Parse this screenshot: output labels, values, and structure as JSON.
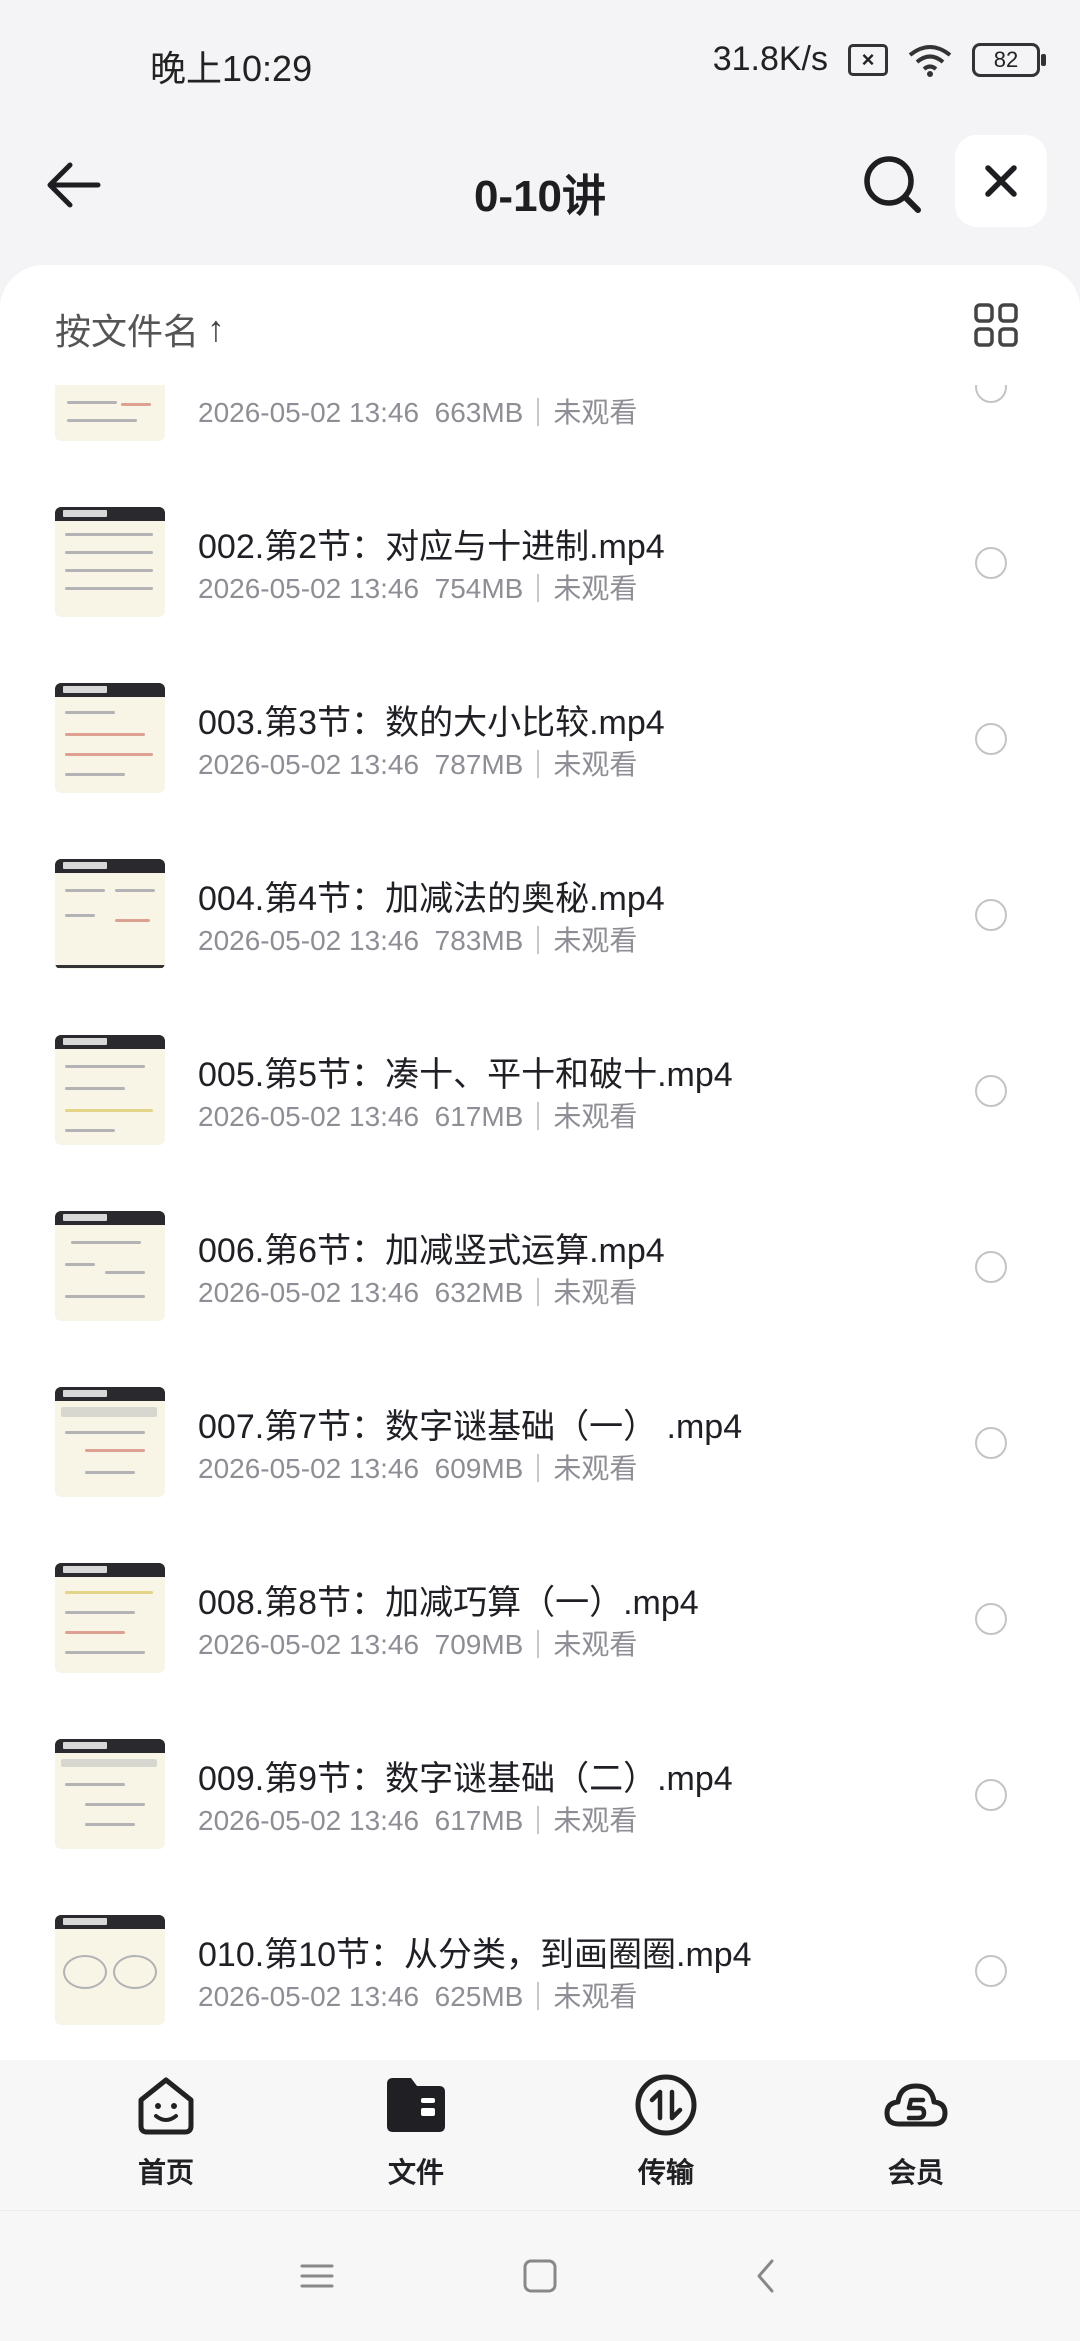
{
  "status_bar": {
    "time": "晚上10:29",
    "net_speed": "31.8K/s",
    "battery": "82"
  },
  "header": {
    "title": "0-10讲"
  },
  "sort": {
    "label": "按文件名",
    "arrow": "↑"
  },
  "files": [
    {
      "name": "",
      "date": "2026-05-02 13:46",
      "size": "663MB",
      "status": "未观看"
    },
    {
      "name": "002.第2节：对应与十进制.mp4",
      "date": "2026-05-02 13:46",
      "size": "754MB",
      "status": "未观看"
    },
    {
      "name": "003.第3节：数的大小比较.mp4",
      "date": "2026-05-02 13:46",
      "size": "787MB",
      "status": "未观看"
    },
    {
      "name": "004.第4节：加减法的奥秘.mp4",
      "date": "2026-05-02 13:46",
      "size": "783MB",
      "status": "未观看"
    },
    {
      "name": "005.第5节：凑十、平十和破十.mp4",
      "date": "2026-05-02 13:46",
      "size": "617MB",
      "status": "未观看"
    },
    {
      "name": "006.第6节：加减竖式运算.mp4",
      "date": "2026-05-02 13:46",
      "size": "632MB",
      "status": "未观看"
    },
    {
      "name": "007.第7节：数字谜基础（一） .mp4",
      "date": "2026-05-02 13:46",
      "size": "609MB",
      "status": "未观看"
    },
    {
      "name": "008.第8节：加减巧算（一）.mp4",
      "date": "2026-05-02 13:46",
      "size": "709MB",
      "status": "未观看"
    },
    {
      "name": "009.第9节：数字谜基础（二）.mp4",
      "date": "2026-05-02 13:46",
      "size": "617MB",
      "status": "未观看"
    },
    {
      "name": "010.第10节：从分类，到画圈圈.mp4",
      "date": "2026-05-02 13:46",
      "size": "625MB",
      "status": "未观看"
    }
  ],
  "tabs": [
    {
      "label": "首页",
      "icon": "home-smile-icon"
    },
    {
      "label": "文件",
      "icon": "folder-icon"
    },
    {
      "label": "传输",
      "icon": "transfer-icon"
    },
    {
      "label": "会员",
      "icon": "vip-cloud-icon"
    }
  ]
}
